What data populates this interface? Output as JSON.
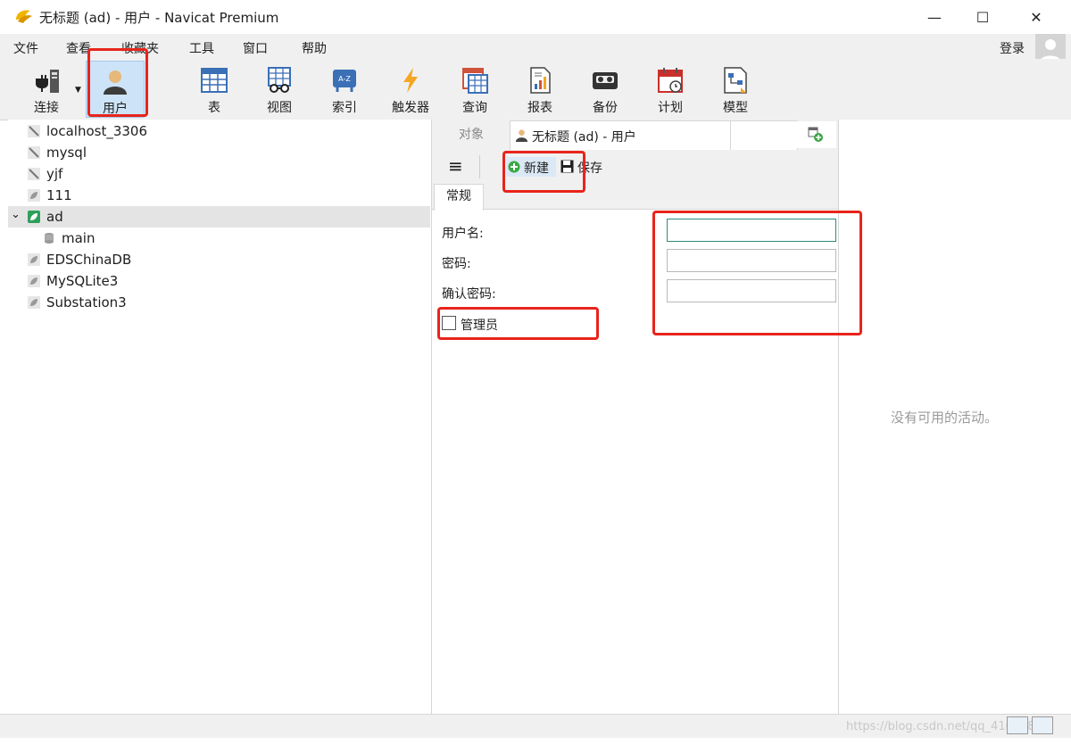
{
  "window": {
    "title": "无标题 (ad) - 用户 - Navicat Premium",
    "controls": {
      "minimize": "—",
      "maximize": "☐",
      "close": "✕"
    }
  },
  "menu": {
    "items": [
      "文件",
      "查看",
      "收藏夹",
      "工具",
      "窗口",
      "帮助"
    ],
    "login": "登录"
  },
  "toolbar": {
    "buttons": [
      {
        "label": "连接",
        "icon": "plug-connection-icon"
      },
      {
        "label": "用户",
        "icon": "user-icon"
      },
      {
        "label": "表",
        "icon": "table-icon"
      },
      {
        "label": "视图",
        "icon": "view-glasses-icon"
      },
      {
        "label": "索引",
        "icon": "index-az-icon"
      },
      {
        "label": "触发器",
        "icon": "lightning-trigger-icon"
      },
      {
        "label": "查询",
        "icon": "query-grid-icon"
      },
      {
        "label": "报表",
        "icon": "report-icon"
      },
      {
        "label": "备份",
        "icon": "backup-tape-icon"
      },
      {
        "label": "计划",
        "icon": "calendar-schedule-icon"
      },
      {
        "label": "模型",
        "icon": "model-diagram-icon"
      }
    ]
  },
  "navigator": {
    "items": [
      {
        "label": "localhost_3306",
        "icon": "mysql-connection-icon"
      },
      {
        "label": "mysql",
        "icon": "mysql-connection-icon"
      },
      {
        "label": "yjf",
        "icon": "mysql-connection-icon"
      },
      {
        "label": "111",
        "icon": "sqlite-connection-icon"
      },
      {
        "label": "ad",
        "icon": "sqlite-connection-icon",
        "selected": true,
        "expanded": true
      },
      {
        "label": "main",
        "icon": "database-icon",
        "child": true
      },
      {
        "label": "EDSChinaDB",
        "icon": "sqlite-connection-icon"
      },
      {
        "label": "MySQLite3",
        "icon": "sqlite-connection-icon"
      },
      {
        "label": "Substation3",
        "icon": "sqlite-connection-icon"
      }
    ]
  },
  "editor": {
    "tabs": {
      "objects": "对象",
      "user_tab": "无标题 (ad) - 用户"
    },
    "toolbar": {
      "new_label": "新建",
      "save_label": "保存"
    },
    "subtab": "常规",
    "fields": {
      "username_label": "用户名:",
      "password_label": "密码:",
      "confirm_label": "确认密码:",
      "username_value": "",
      "password_value": "",
      "confirm_value": ""
    },
    "admin_label": "管理员",
    "admin_checked": false
  },
  "activity": {
    "empty_text": "没有可用的活动。"
  },
  "statusbar": {
    "watermark": "https://blog.csdn.net/qq_41059890"
  },
  "colors": {
    "annotation": "#e8241c",
    "accent": "#2e8b7c",
    "selection": "#cde3f7"
  }
}
